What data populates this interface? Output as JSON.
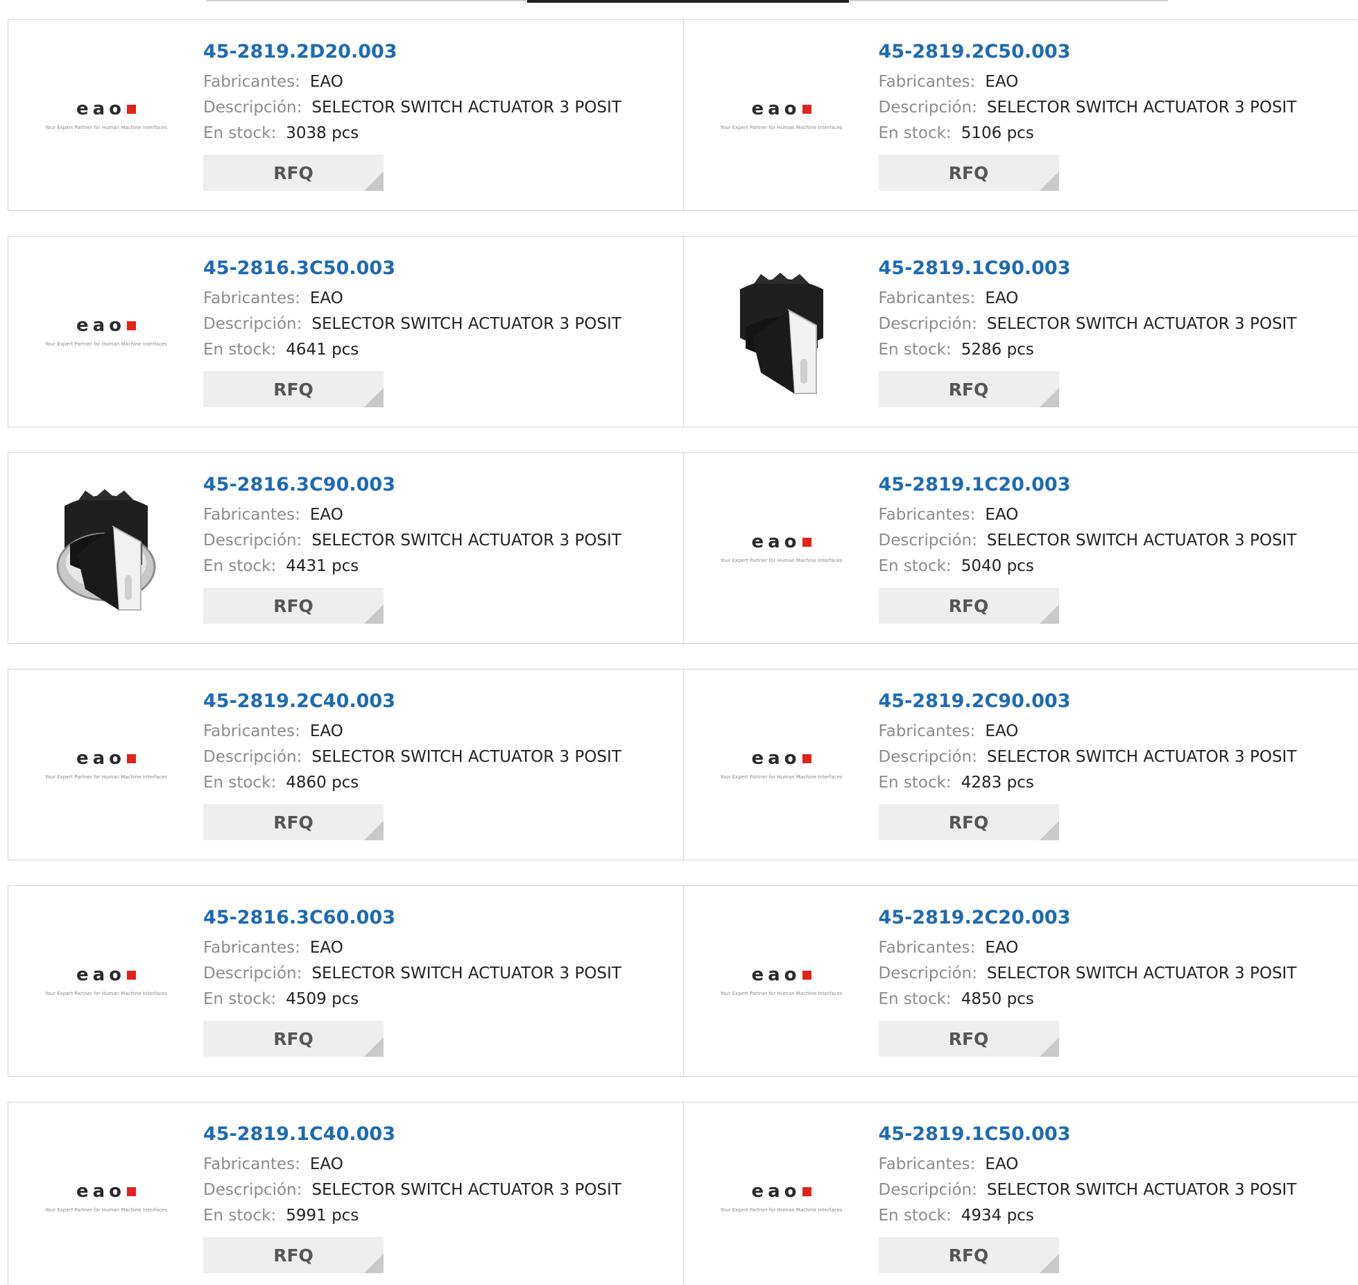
{
  "labels": {
    "manufacturer": "Fabricantes:",
    "description": "Descripción:",
    "stock": "En stock:",
    "rfq": "RFQ"
  },
  "logo": {
    "brand": "eao",
    "tagline": "Your Expert Partner for Human Machine Interfaces"
  },
  "products": [
    {
      "part": "45-2819.2D20.003",
      "manufacturer": "EAO",
      "description": "SELECTOR SWITCH ACTUATOR 3 POSIT",
      "stock": "3038 pcs",
      "image": "eao-logo"
    },
    {
      "part": "45-2819.2C50.003",
      "manufacturer": "EAO",
      "description": "SELECTOR SWITCH ACTUATOR 3 POSIT",
      "stock": "5106 pcs",
      "image": "eao-logo"
    },
    {
      "part": "45-2816.3C50.003",
      "manufacturer": "EAO",
      "description": "SELECTOR SWITCH ACTUATOR 3 POSIT",
      "stock": "4641 pcs",
      "image": "eao-logo"
    },
    {
      "part": "45-2819.1C90.003",
      "manufacturer": "EAO",
      "description": "SELECTOR SWITCH ACTUATOR 3 POSIT",
      "stock": "5286 pcs",
      "image": "selector-switch-black"
    },
    {
      "part": "45-2816.3C90.003",
      "manufacturer": "EAO",
      "description": "SELECTOR SWITCH ACTUATOR 3 POSIT",
      "stock": "4431 pcs",
      "image": "selector-switch-chrome"
    },
    {
      "part": "45-2819.1C20.003",
      "manufacturer": "EAO",
      "description": "SELECTOR SWITCH ACTUATOR 3 POSIT",
      "stock": "5040 pcs",
      "image": "eao-logo"
    },
    {
      "part": "45-2819.2C40.003",
      "manufacturer": "EAO",
      "description": "SELECTOR SWITCH ACTUATOR 3 POSIT",
      "stock": "4860 pcs",
      "image": "eao-logo"
    },
    {
      "part": "45-2819.2C90.003",
      "manufacturer": "EAO",
      "description": "SELECTOR SWITCH ACTUATOR 3 POSIT",
      "stock": "4283 pcs",
      "image": "eao-logo"
    },
    {
      "part": "45-2816.3C60.003",
      "manufacturer": "EAO",
      "description": "SELECTOR SWITCH ACTUATOR 3 POSIT",
      "stock": "4509 pcs",
      "image": "eao-logo"
    },
    {
      "part": "45-2819.2C20.003",
      "manufacturer": "EAO",
      "description": "SELECTOR SWITCH ACTUATOR 3 POSIT",
      "stock": "4850 pcs",
      "image": "eao-logo"
    },
    {
      "part": "45-2819.1C40.003",
      "manufacturer": "EAO",
      "description": "SELECTOR SWITCH ACTUATOR 3 POSIT",
      "stock": "5991 pcs",
      "image": "eao-logo"
    },
    {
      "part": "45-2819.1C50.003",
      "manufacturer": "EAO",
      "description": "SELECTOR SWITCH ACTUATOR 3 POSIT",
      "stock": "4934 pcs",
      "image": "eao-logo"
    }
  ],
  "colors": {
    "part_link": "#1d6ab5",
    "brand_red": "#e2231a",
    "label_gray": "#8c8c8c",
    "button_bg": "#eeeeee"
  }
}
